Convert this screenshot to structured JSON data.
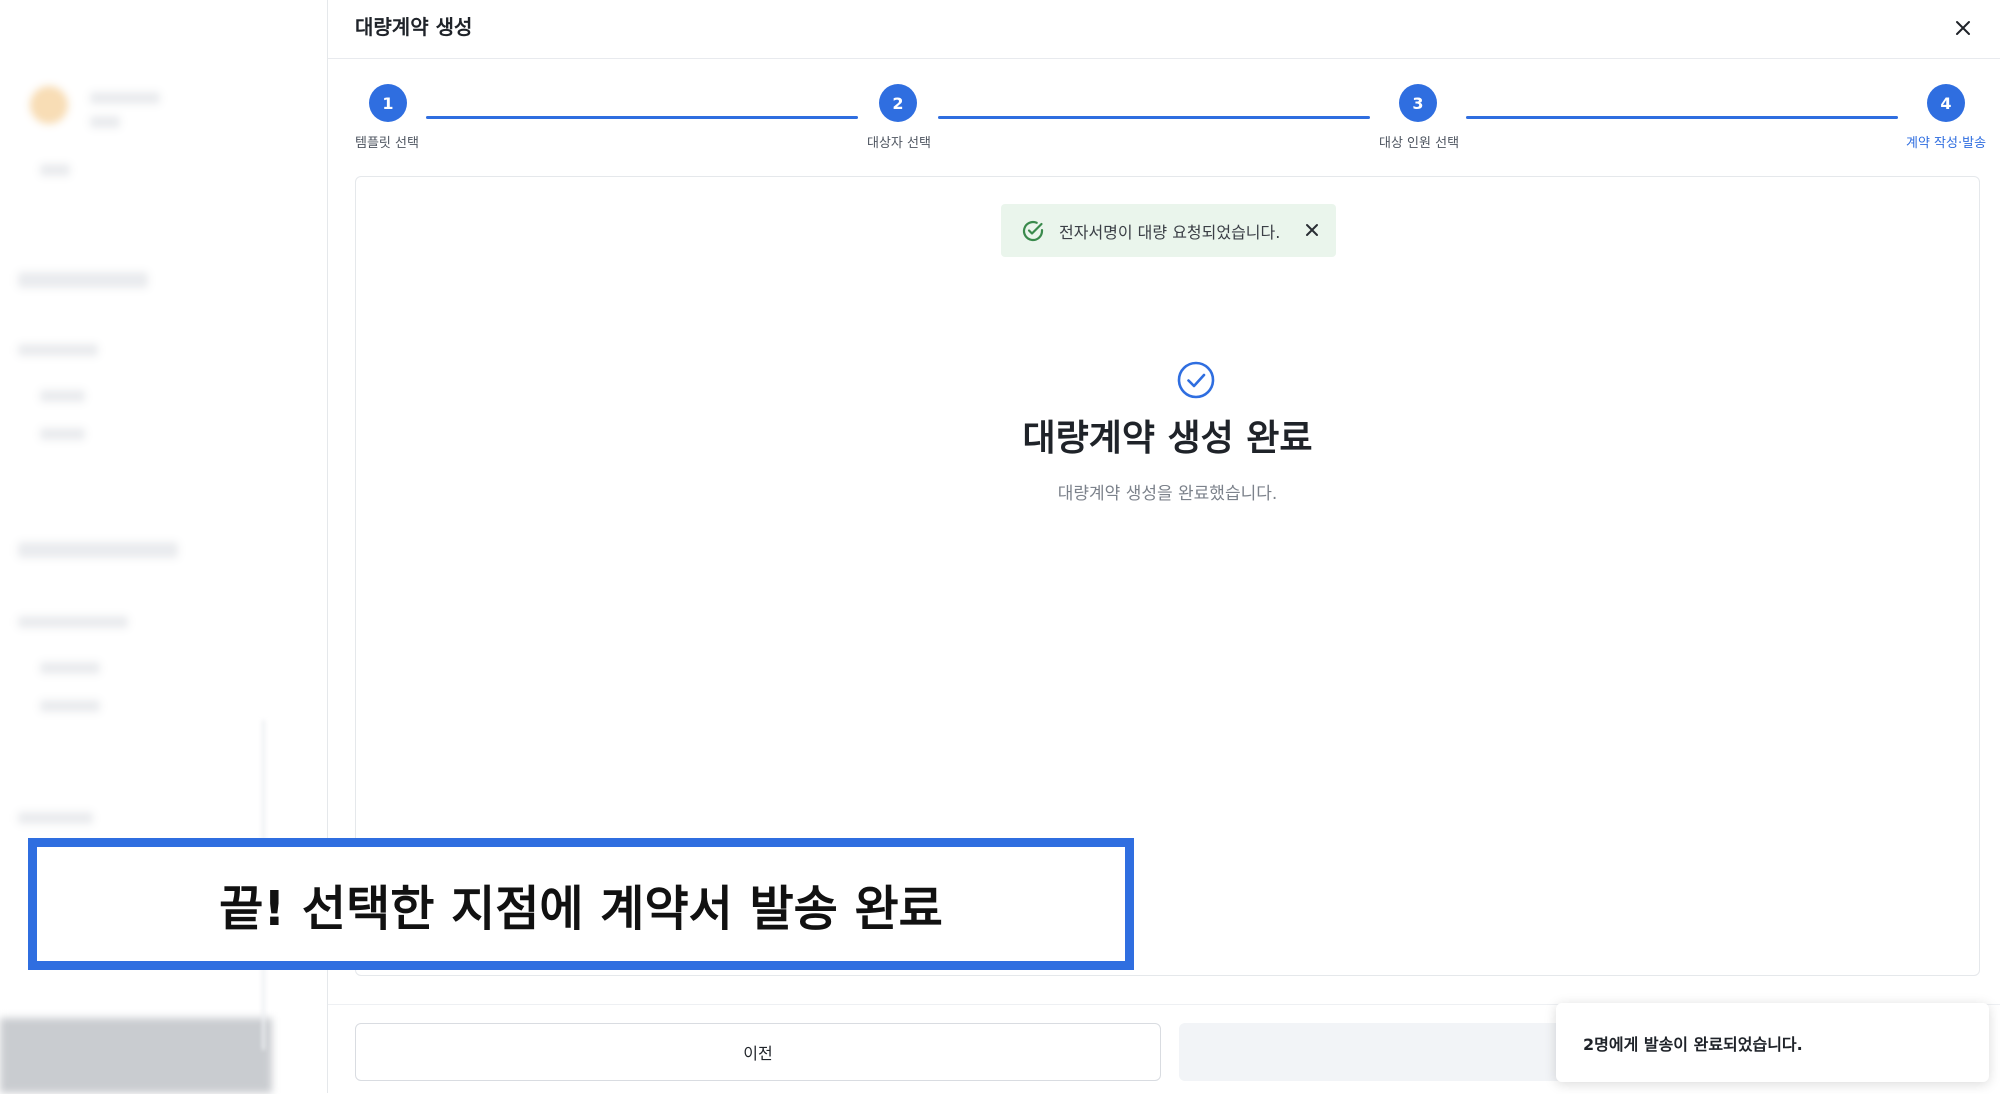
{
  "modal": {
    "title": "대량계약 생성"
  },
  "steps": [
    {
      "number": "1",
      "label": "템플릿 선택"
    },
    {
      "number": "2",
      "label": "대상자 선택"
    },
    {
      "number": "3",
      "label": "대상 인원 선택"
    },
    {
      "number": "4",
      "label": "계약 작성·발송"
    }
  ],
  "toast": {
    "message": "전자서명이 대량 요청되었습니다."
  },
  "completion": {
    "title": "대량계약 생성 완료",
    "subtitle": "대량계약 생성을 완료했습니다."
  },
  "footer": {
    "prev_label": "이전"
  },
  "notification": {
    "message": "2명에게 발송이 완료되었습니다."
  },
  "caption": {
    "text": "끝! 선택한 지점에 계약서 발송 완료"
  },
  "colors": {
    "accent": "#2f6ee0",
    "success_bg": "#eaf5ec",
    "success_icon": "#3a8a4c"
  }
}
